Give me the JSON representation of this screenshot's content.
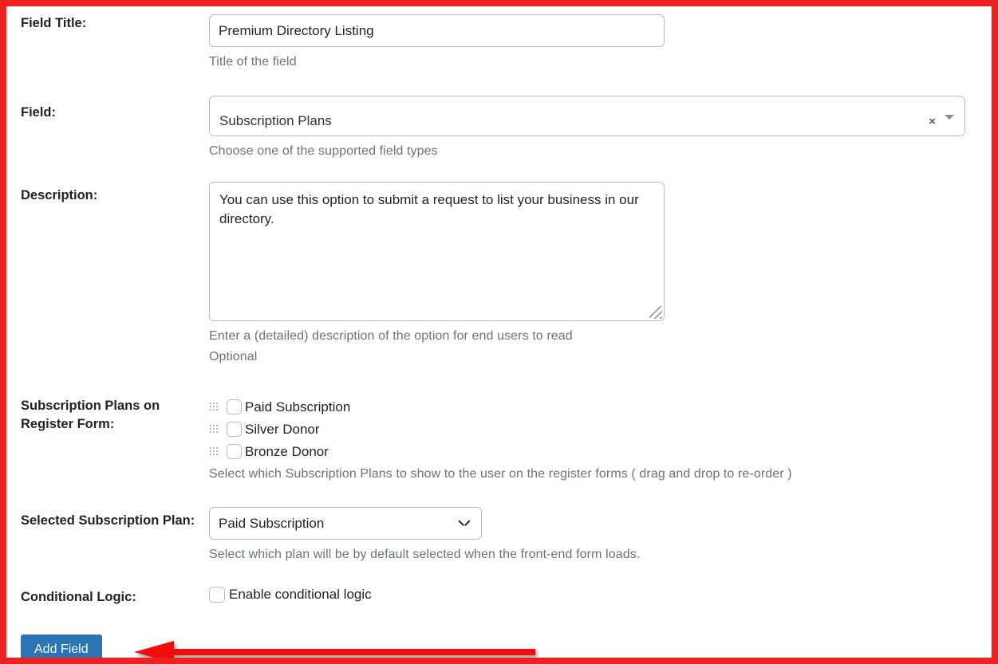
{
  "form": {
    "field_title": {
      "label": "Field Title:",
      "value": "Premium Directory Listing",
      "help": "Title of the field"
    },
    "field_type": {
      "label": "Field:",
      "value": "Subscription Plans",
      "help": "Choose one of the supported field types",
      "clear_icon": "close-x-icon",
      "caret_icon": "caret-down-icon"
    },
    "description": {
      "label": "Description:",
      "value": "You can use this option to submit a request to list your business in our directory.",
      "help_line_1": "Enter a (detailed) description of the option for end users to read",
      "help_line_2": "Optional",
      "grip_icon": "resize-grip-icon"
    },
    "subscription_plans": {
      "label": "Subscription Plans on Register Form:",
      "label_line_1": "Subscription Plans on",
      "label_line_2": "Register Form:",
      "help": "Select which Subscription Plans to show to the user on the register forms ( drag and drop to re-order )",
      "options": [
        {
          "label": "Paid Subscription",
          "checked": false
        },
        {
          "label": "Silver Donor",
          "checked": false
        },
        {
          "label": "Bronze Donor",
          "checked": false
        }
      ]
    },
    "selected_plan": {
      "label": "Selected Subscription Plan:",
      "value": "Paid Subscription",
      "help": "Select which plan will be by default selected when the front-end form loads.",
      "options": [
        "Paid Subscription",
        "Silver Donor",
        "Bronze Donor"
      ]
    },
    "conditional_logic": {
      "label": "Conditional Logic:",
      "checkbox_label": "Enable conditional logic",
      "checked": false
    },
    "submit": {
      "label": "Add Field"
    }
  },
  "annotation": {
    "border_color": "#ee2222",
    "arrow_color": "#ef1111",
    "arrow_points_to": "add-field-button"
  },
  "colors": {
    "button_blue": "#2a74b3",
    "label_text": "#1d2327",
    "help_text": "#6b7280",
    "border_gray": "#b9bcbf"
  }
}
